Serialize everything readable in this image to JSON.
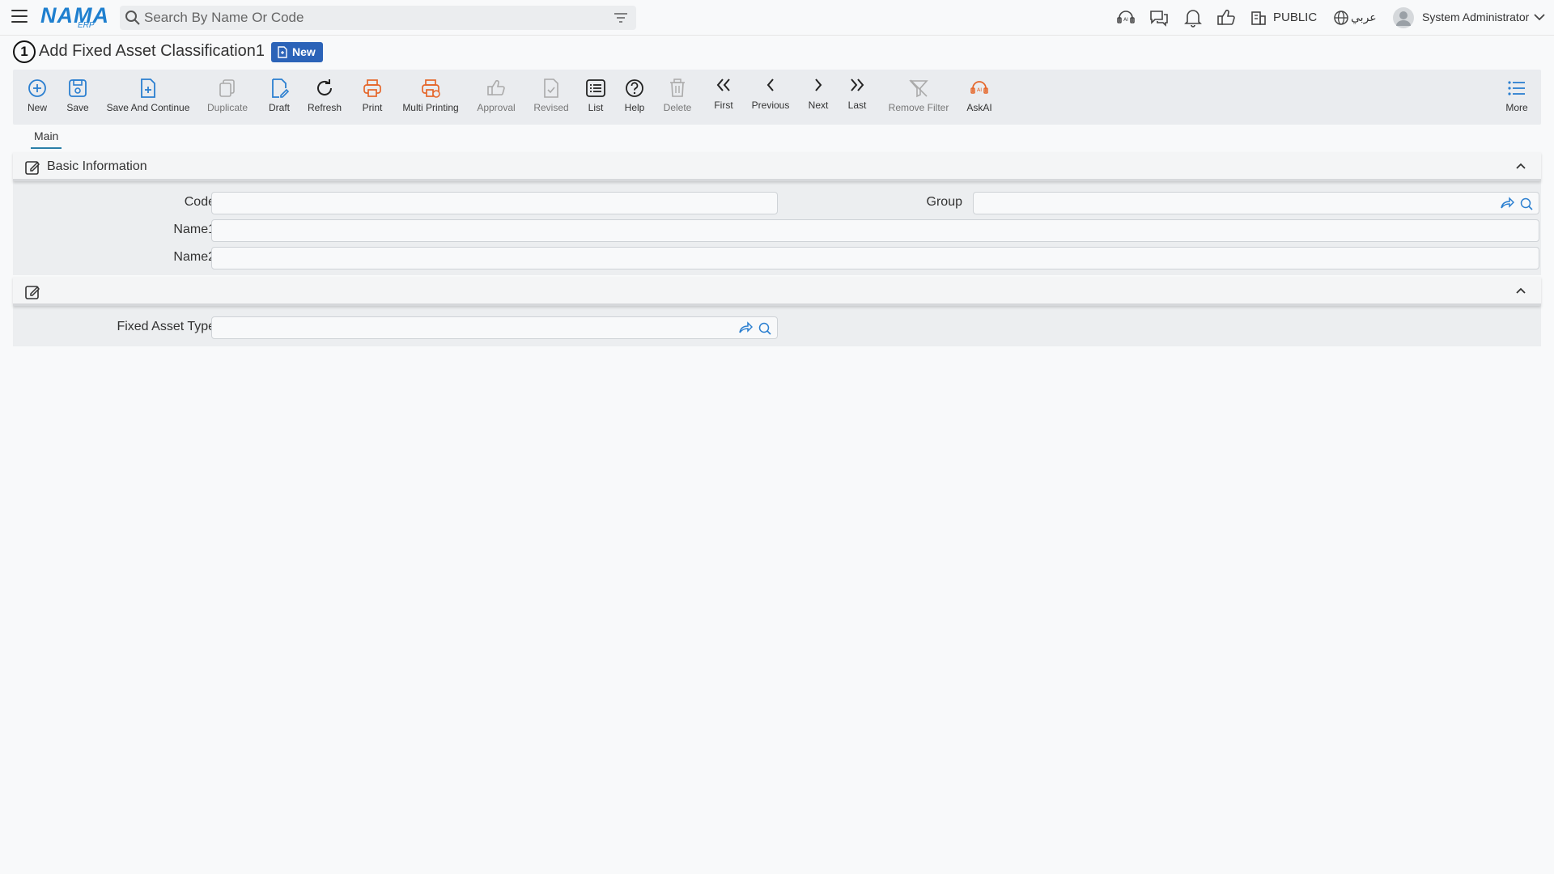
{
  "topbar": {
    "logo_main": "NAMA",
    "logo_sub": "ERP",
    "search_placeholder": "Search By Name Or Code",
    "branch": "PUBLIC",
    "language": "عربي",
    "user": "System Administrator",
    "icons": [
      "menu-icon",
      "search-icon",
      "filter-icon",
      "ai-icon",
      "chat-icon",
      "bell-icon",
      "thumbs-up-icon",
      "building-icon",
      "globe-icon",
      "avatar-icon",
      "chevron-down-icon"
    ]
  },
  "page": {
    "step": "1",
    "title": "Add Fixed Asset Classification1",
    "badge": "New"
  },
  "toolbar": {
    "new": "New",
    "save": "Save",
    "save_continue": "Save And Continue",
    "duplicate": "Duplicate",
    "draft": "Draft",
    "refresh": "Refresh",
    "print": "Print",
    "multi_printing": "Multi Printing",
    "approval": "Approval",
    "revised": "Revised",
    "list": "List",
    "help": "Help",
    "delete": "Delete",
    "first": "First",
    "previous": "Previous",
    "next": "Next",
    "last": "Last",
    "remove_filter": "Remove Filter",
    "askai": "AskAI",
    "more": "More"
  },
  "tabs": {
    "main": "Main"
  },
  "basic_info": {
    "title": "Basic Information",
    "code_label": "Code",
    "code_value": "",
    "group_label": "Group",
    "group_value": "",
    "name1_label": "Name1",
    "name1_value": "",
    "name2_label": "Name2",
    "name2_value": ""
  },
  "section2": {
    "title": "",
    "fixed_asset_type_label": "Fixed Asset Type",
    "fixed_asset_type_value": ""
  },
  "colors": {
    "accent_blue": "#2b7fd0",
    "accent_orange": "#e5662a",
    "badge_blue": "#2b63b8",
    "disabled_gray": "#aaaaaa"
  }
}
